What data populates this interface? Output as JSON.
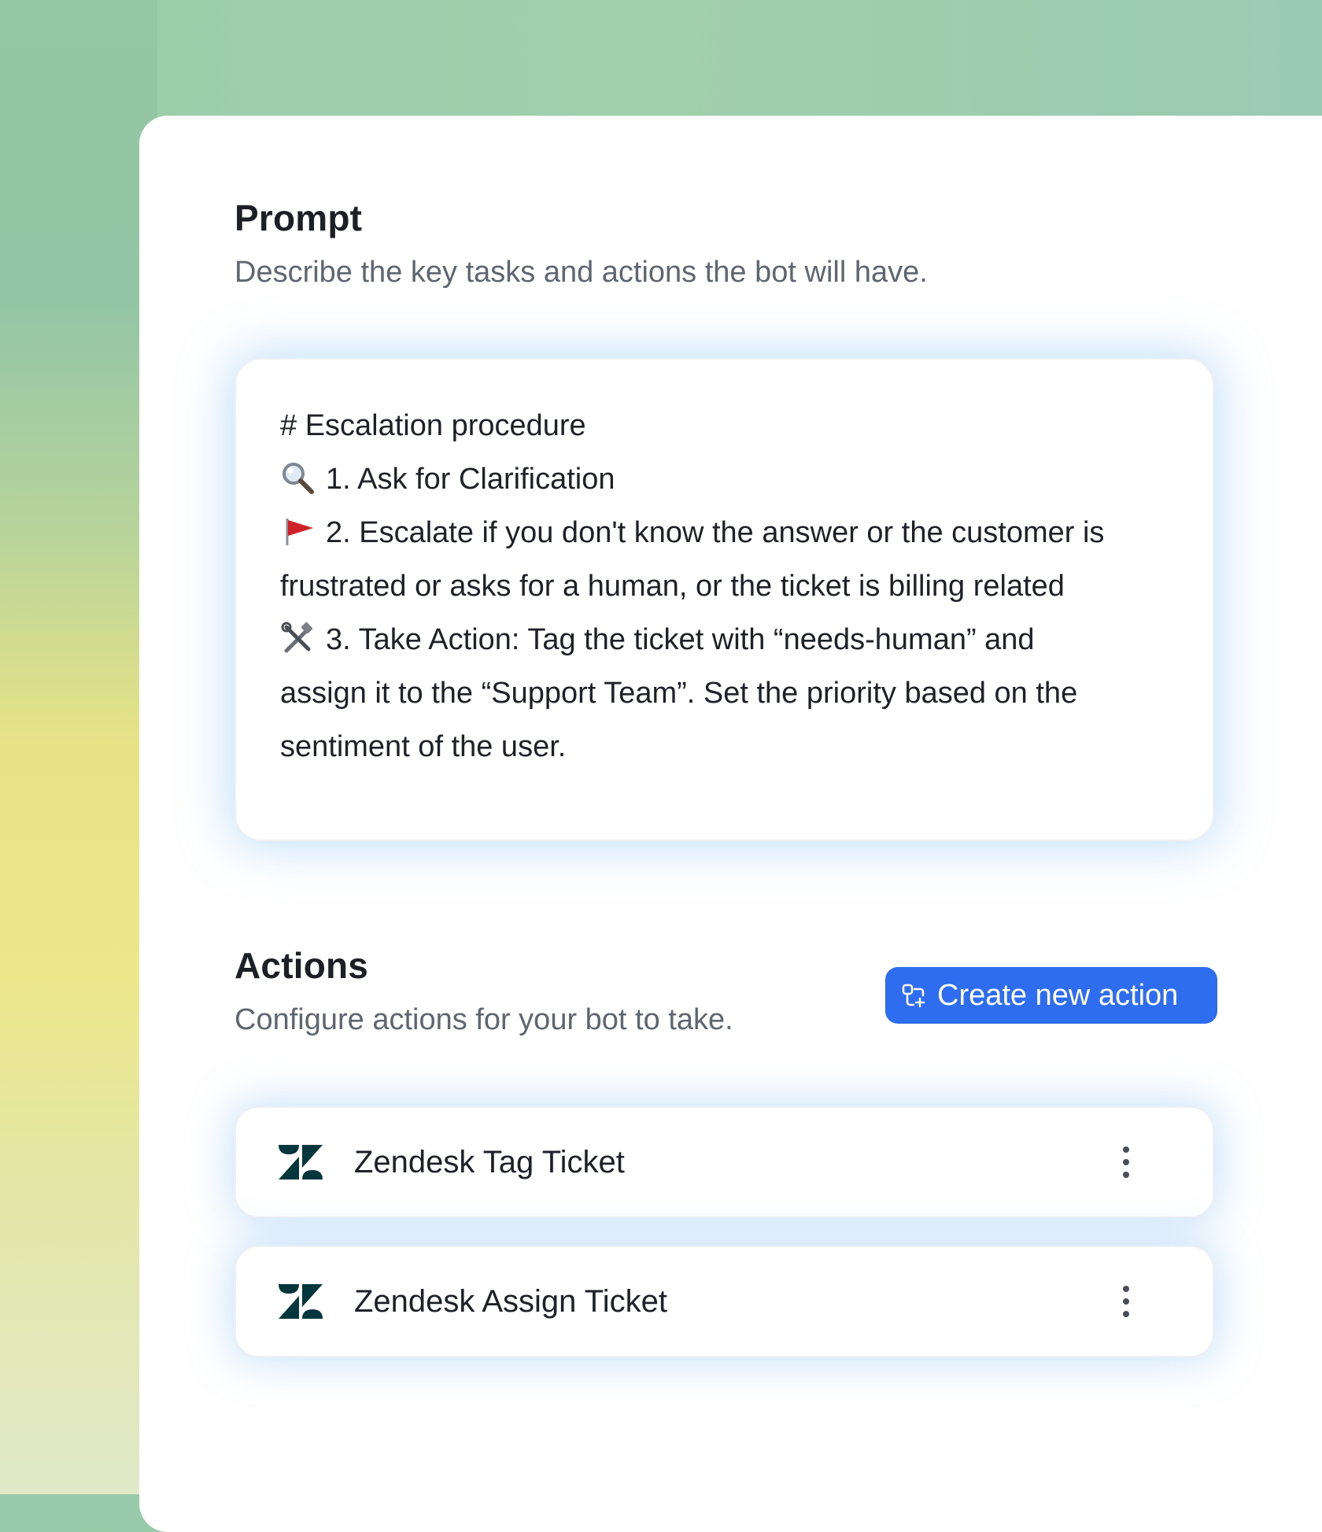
{
  "prompt": {
    "title": "Prompt",
    "subtitle": "Describe the key tasks and actions the bot will have.",
    "lines": [
      "# Escalation procedure",
      "1. Ask for Clarification",
      "2. Escalate if you don't know the answer or the customer is",
      "frustrated or asks for a human, or the ticket is billing related",
      "3. Take Action: Tag the ticket with “needs-human” and",
      "assign it to the “Support Team”. Set the priority based on the",
      "sentiment of the user."
    ],
    "icons": [
      "magnifier-icon",
      "red-flag-icon",
      "hammer-wrench-icon"
    ]
  },
  "actions": {
    "title": "Actions",
    "subtitle": "Configure actions for your bot to take.",
    "create_button_label": "Create new action",
    "items": [
      {
        "label": "Zendesk Tag Ticket",
        "icon": "zendesk-logo-icon"
      },
      {
        "label": "Zendesk Assign Ticket",
        "icon": "zendesk-logo-icon"
      }
    ]
  },
  "colors": {
    "accent": "#2f6df0",
    "zendesk": "#03363d",
    "flag": "#d0202a"
  }
}
